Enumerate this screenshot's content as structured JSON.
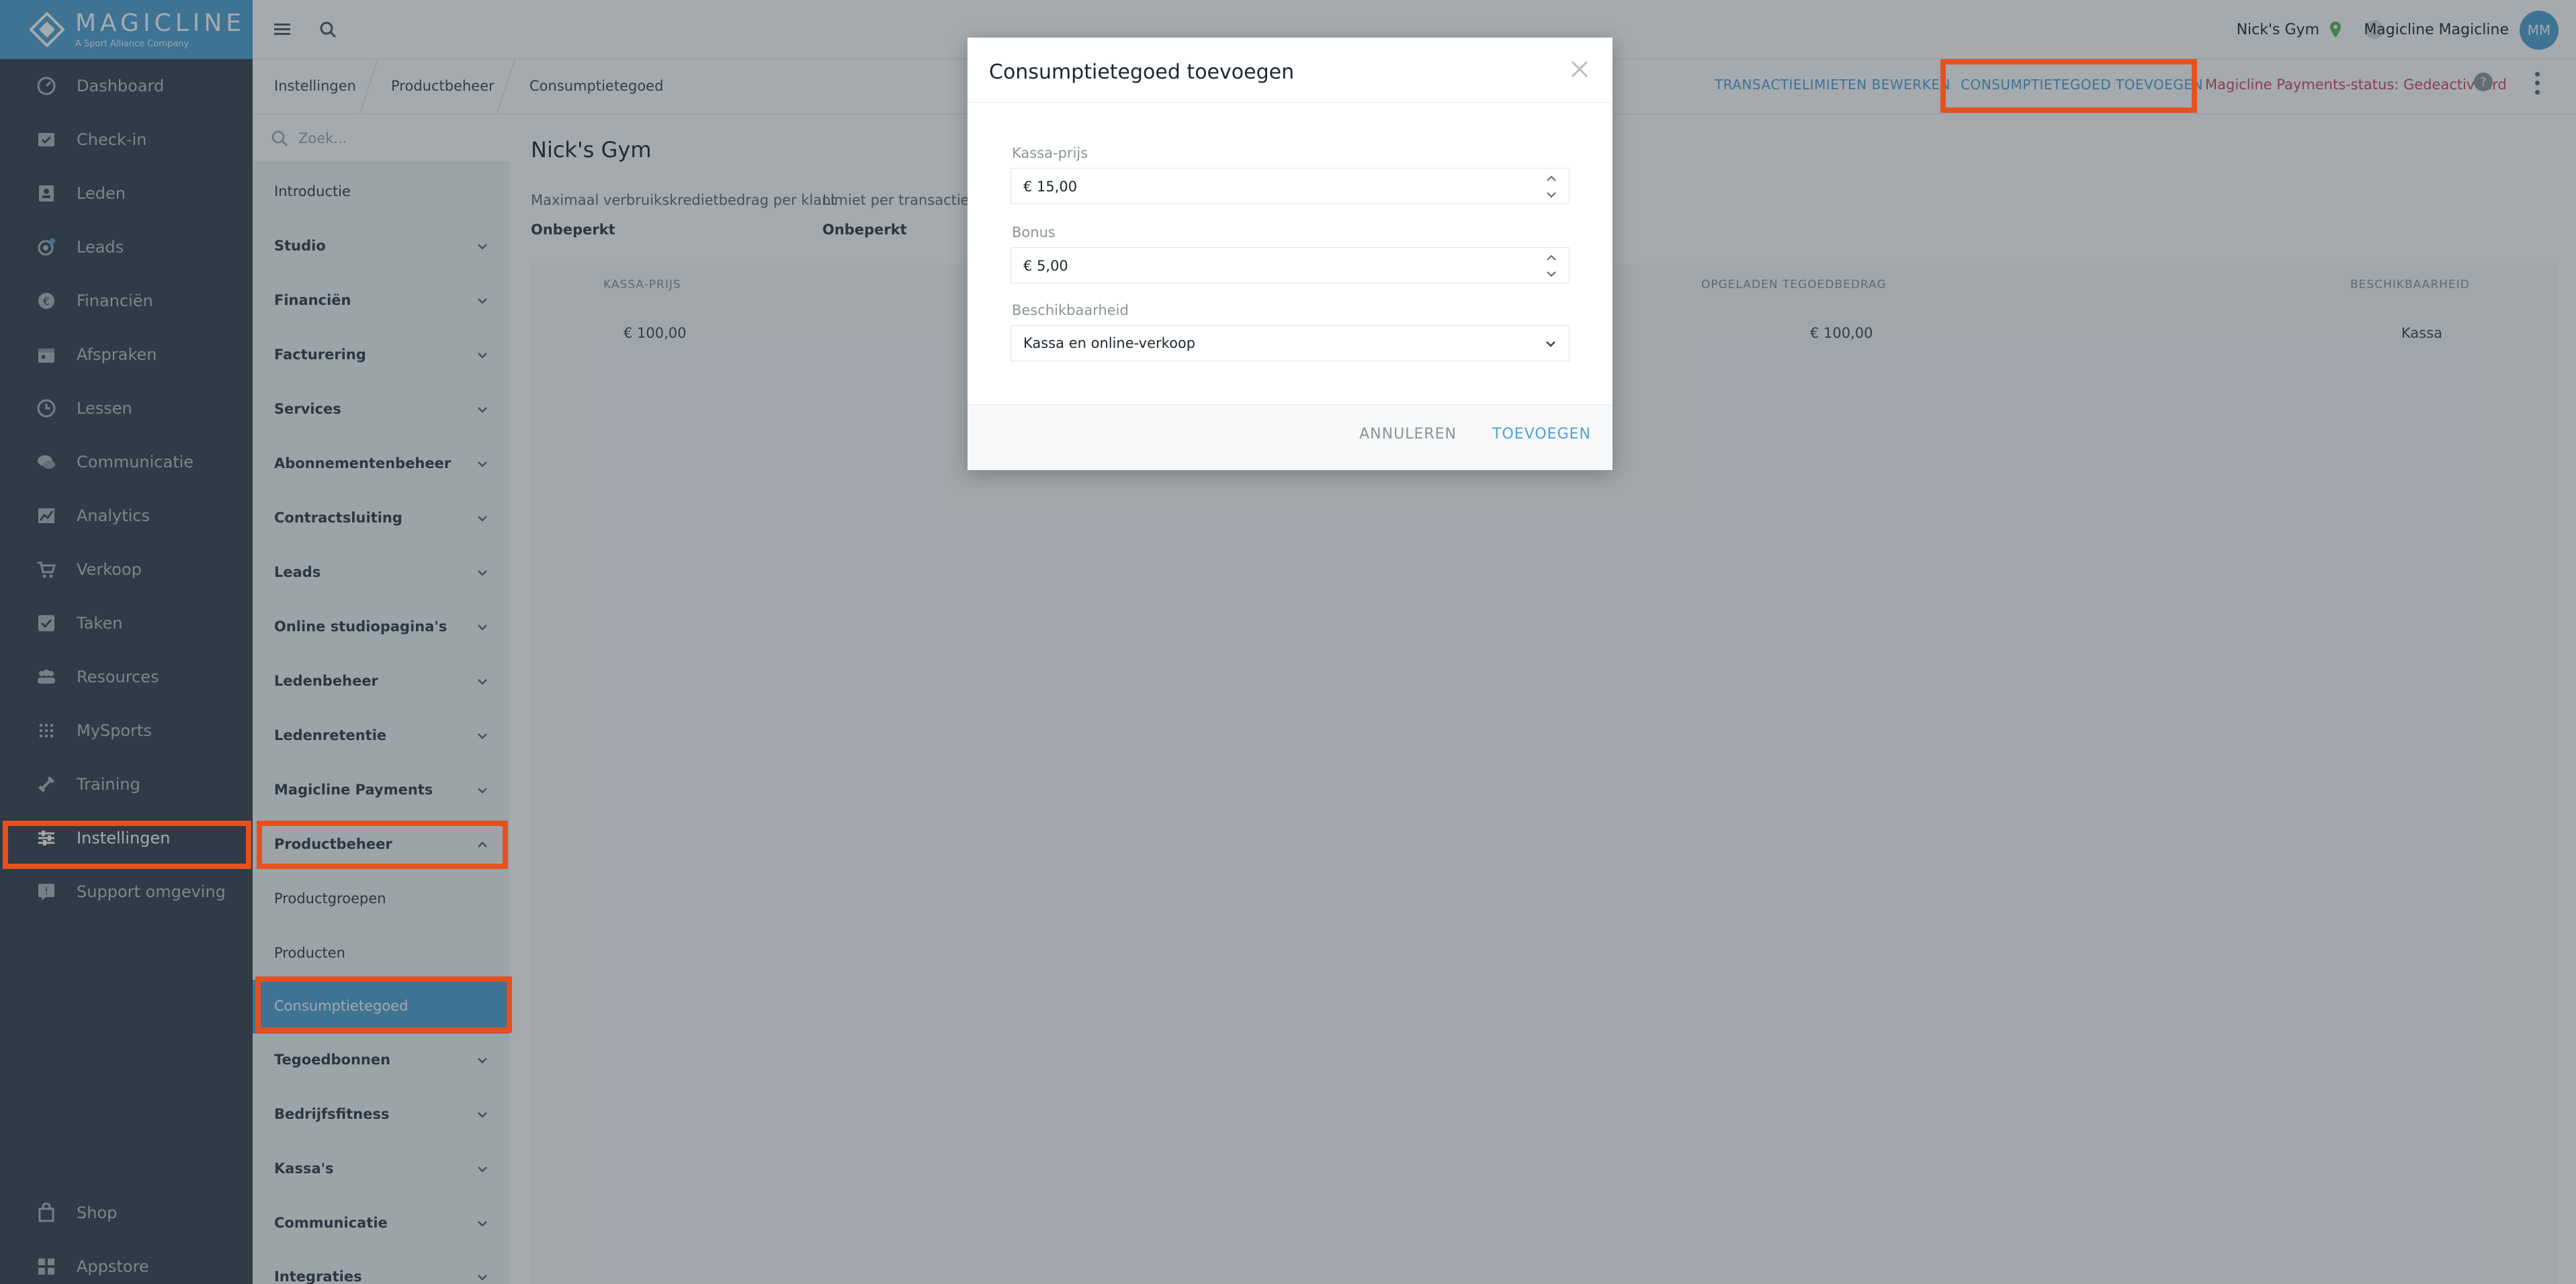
{
  "brand": {
    "name": "MAGICLINE",
    "tagline": "A Sport Alliance Company",
    "accent_color": "#4ea1d3"
  },
  "sidebar": {
    "items": [
      {
        "label": "Dashboard",
        "icon": "dashboard-icon"
      },
      {
        "label": "Check-in",
        "icon": "checkin-icon"
      },
      {
        "label": "Leden",
        "icon": "members-icon"
      },
      {
        "label": "Leads",
        "icon": "leads-icon"
      },
      {
        "label": "Financiën",
        "icon": "finance-icon"
      },
      {
        "label": "Afspraken",
        "icon": "calendar-icon"
      },
      {
        "label": "Lessen",
        "icon": "classes-icon"
      },
      {
        "label": "Communicatie",
        "icon": "chat-icon"
      },
      {
        "label": "Analytics",
        "icon": "analytics-icon"
      },
      {
        "label": "Verkoop",
        "icon": "cart-icon"
      },
      {
        "label": "Taken",
        "icon": "tasks-icon"
      },
      {
        "label": "Resources",
        "icon": "resources-icon"
      },
      {
        "label": "MySports",
        "icon": "mysports-icon"
      },
      {
        "label": "Training",
        "icon": "training-icon"
      },
      {
        "label": "Instellingen",
        "icon": "settings-sliders-icon"
      },
      {
        "label": "Support omgeving",
        "icon": "support-icon"
      },
      {
        "label": "Shop",
        "icon": "shop-icon"
      },
      {
        "label": "Appstore",
        "icon": "appstore-icon"
      }
    ]
  },
  "topbar": {
    "gym_name": "Nick's Gym",
    "user_name": "Magicline Magicline",
    "avatar_initials": "MM"
  },
  "breadcrumb": [
    "Instellingen",
    "Productbeheer",
    "Consumptietegoed"
  ],
  "actions": {
    "edit_limits": "TRANSACTIELIMIETEN BEWERKEN",
    "add_credit": "CONSUMPTIETEGOED TOEVOEGEN",
    "payments_status": "Magicline Payments-status: Gedeactiveerd"
  },
  "settings_menu": {
    "search_placeholder": "Zoek...",
    "items": [
      "Introductie",
      "Studio",
      "Financiën",
      "Facturering",
      "Services",
      "Abonnementenbeheer",
      "Contractsluiting",
      "Leads",
      "Online studiopagina's",
      "Ledenbeheer",
      "Ledenretentie",
      "Magicline Payments",
      "Productbeheer",
      "Productgroepen",
      "Producten",
      "Consumptietegoed",
      "Tegoedbonnen",
      "Bedrijfsfitness",
      "Kassa's",
      "Communicatie",
      "Integraties"
    ]
  },
  "main": {
    "title": "Nick's Gym",
    "max_credit_label": "Maximaal verbruikskredietbedrag per klant",
    "max_credit_value": "Onbeperkt",
    "tx_limit_label": "Limiet per transactie",
    "tx_limit_value": "Onbeperkt",
    "table": {
      "headers": [
        "KASSA-PRIJS",
        "OPGELADEN TEGOEDBEDRAG",
        "BESCHIKBAARHEID"
      ],
      "row": [
        "€ 100,00",
        "€ 100,00",
        "Kassa"
      ]
    }
  },
  "modal": {
    "title": "Consumptietegoed toevoegen",
    "price_label": "Kassa-prijs",
    "price_value": "€ 15,00",
    "bonus_label": "Bonus",
    "bonus_value": "€ 5,00",
    "availability_label": "Beschikbaarheid",
    "availability_value": "Kassa en online-verkoop",
    "cancel_label": "ANNULEREN",
    "submit_label": "TOEVOEGEN"
  }
}
